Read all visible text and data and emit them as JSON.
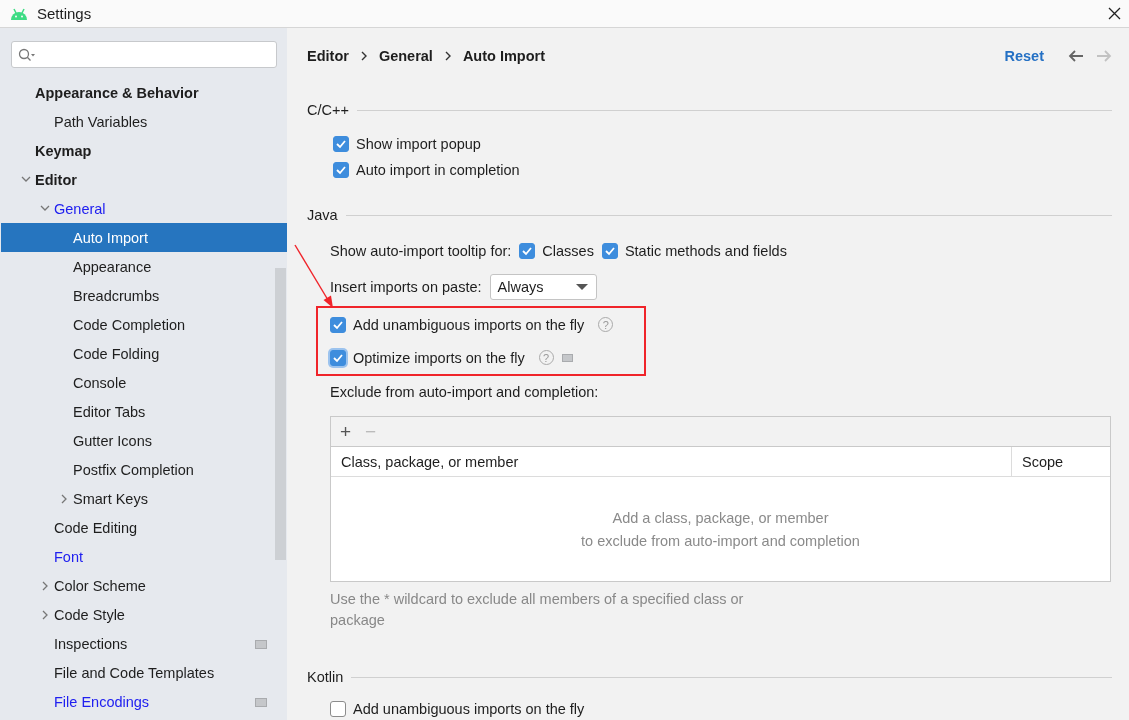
{
  "window": {
    "title": "Settings"
  },
  "sidebar": {
    "items": [
      {
        "label": "Appearance & Behavior",
        "children": [
          {
            "label": "Path Variables"
          }
        ]
      },
      {
        "label": "Keymap"
      },
      {
        "label": "Editor",
        "expanded": true,
        "children": [
          {
            "label": "General",
            "expanded": true,
            "modified": true,
            "children": [
              {
                "label": "Auto Import",
                "selected": true
              },
              {
                "label": "Appearance",
                "selected": false
              },
              {
                "label": "Breadcrumbs",
                "selected": false
              },
              {
                "label": "Code Completion",
                "selected": false
              },
              {
                "label": "Code Folding",
                "selected": false
              },
              {
                "label": "Console",
                "selected": false
              },
              {
                "label": "Editor Tabs",
                "selected": false
              },
              {
                "label": "Gutter Icons",
                "selected": false
              },
              {
                "label": "Postfix Completion",
                "selected": false
              },
              {
                "label": "Smart Keys",
                "expanded": false,
                "selected": false
              }
            ]
          },
          {
            "label": "Code Editing",
            "selected": false
          },
          {
            "label": "Font",
            "modified": true,
            "selected": false
          },
          {
            "label": "Color Scheme",
            "expanded": false,
            "selected": false
          },
          {
            "label": "Code Style",
            "expanded": false,
            "selected": false
          },
          {
            "label": "Inspections",
            "scope_icon": true,
            "selected": false
          },
          {
            "label": "File and Code Templates",
            "selected": false
          },
          {
            "label": "File Encodings",
            "modified": true,
            "scope_icon": true,
            "selected": false
          }
        ]
      }
    ]
  },
  "breadcrumb": [
    "Editor",
    "General",
    "Auto Import"
  ],
  "reset": "Reset",
  "nav": [
    {
      "kind": "back",
      "disabled": false
    },
    {
      "kind": "forward",
      "disabled": true
    }
  ],
  "sections": [
    {
      "title": "C/C++",
      "rows": [
        {
          "kind": "checkbox",
          "label": "Show import popup",
          "checked": true
        },
        {
          "kind": "checkbox",
          "label": "Auto import in completion",
          "checked": true
        }
      ]
    },
    {
      "title": "Java",
      "rows": [
        {
          "kind": "checkboxes",
          "label": "Show auto-import tooltip for:",
          "options": [
            {
              "label": "Classes",
              "checked": true
            },
            {
              "label": "Static methods and fields",
              "checked": true
            }
          ]
        },
        {
          "kind": "dropdown",
          "label": "Insert imports on paste:",
          "value": "Always"
        },
        {
          "kind": "annotated",
          "rows": [
            {
              "kind": "checkbox",
              "label": "Add unambiguous imports on the fly",
              "checked": true,
              "help": "?"
            },
            {
              "kind": "checkbox",
              "label": "Optimize imports on the fly",
              "checked": true,
              "focused": true,
              "help": "?",
              "scope_icon": true
            }
          ]
        },
        {
          "kind": "label",
          "text": "Exclude from auto-import and completion:"
        },
        {
          "kind": "table",
          "tools": [
            {
              "symbol": "+",
              "disabled": false
            },
            {
              "symbol": "−",
              "disabled": true
            }
          ],
          "columns": [
            "Class, package, or member",
            "Scope"
          ],
          "empty_text": [
            "Add a class, package, or member",
            "to exclude from auto-import and completion"
          ]
        },
        {
          "kind": "hint",
          "text": "Use the * wildcard to exclude all members of a specified class or package"
        }
      ]
    },
    {
      "title": "Kotlin",
      "rows": [
        {
          "kind": "checkbox",
          "label": "Add unambiguous imports on the fly",
          "checked": false
        }
      ]
    }
  ]
}
